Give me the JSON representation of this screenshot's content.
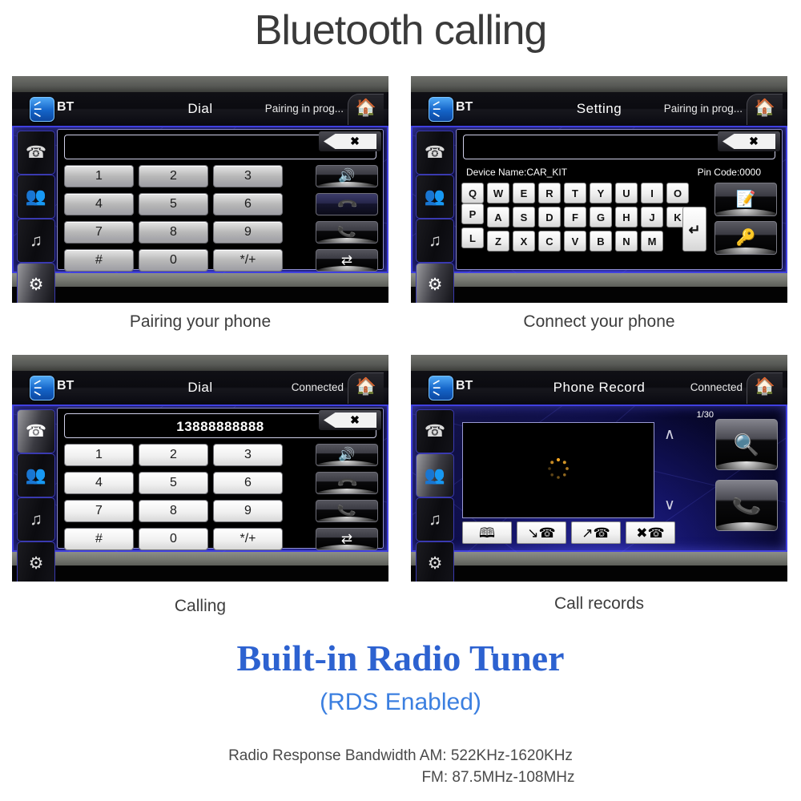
{
  "page": {
    "title": "Bluetooth calling",
    "radio_title": "Built-in Radio Tuner",
    "radio_subtitle": "(RDS Enabled)",
    "radio_spec_line1": "Radio Response Bandwidth AM: 522KHz-1620KHz",
    "radio_spec_line2": "FM: 87.5MHz-108MHz",
    "accent_blue": "#2d62d0",
    "accent_light_blue": "#3b7fe0",
    "screen_border_blue": "#4040e0"
  },
  "common": {
    "bt_badge_icon": "bluetooth-icon",
    "bt_label": "BT",
    "home_icon": "home-icon",
    "delete_icon": "backspace-delete-icon",
    "rail": [
      {
        "icon": "phone-icon",
        "name": "phone"
      },
      {
        "icon": "contacts-icon",
        "name": "contacts"
      },
      {
        "icon": "bt-music-icon",
        "name": "bt-music"
      },
      {
        "icon": "gear-icon",
        "name": "settings"
      }
    ],
    "keypad_keys": [
      "1",
      "2",
      "3",
      "4",
      "5",
      "6",
      "7",
      "8",
      "9",
      "#",
      "0",
      "*/+"
    ],
    "dial_actions": [
      {
        "icon": "speaker-transfer-icon",
        "name": "audio-transfer"
      },
      {
        "icon": "end-call-icon",
        "name": "end-call"
      },
      {
        "icon": "answer-call-icon",
        "name": "answer-call"
      },
      {
        "icon": "swap-icon",
        "name": "swap-audio"
      }
    ]
  },
  "panels": [
    {
      "id": "pairing",
      "title": "Dial",
      "status": "Pairing in prog...",
      "selected_rail": 3,
      "number_value": "",
      "caption": "Pairing your phone"
    },
    {
      "id": "setting",
      "title": "Setting",
      "status": "Pairing in prog...",
      "selected_rail": 3,
      "input_value": "",
      "device_name_label": "Device Name:CAR_KIT",
      "pin_code_label": "Pin Code:0000",
      "keyboard_row1": [
        "Q",
        "W",
        "E",
        "R",
        "T",
        "Y",
        "U",
        "I",
        "O",
        "P"
      ],
      "keyboard_row2": [
        "A",
        "S",
        "D",
        "F",
        "G",
        "H",
        "J",
        "K",
        "L"
      ],
      "keyboard_row3": [
        "Z",
        "X",
        "C",
        "V",
        "B",
        "N",
        "M"
      ],
      "enter_key": "enter-key",
      "side_buttons": [
        {
          "icon": "edit-name-icon",
          "name": "edit-device-name"
        },
        {
          "icon": "edit-pin-icon",
          "name": "edit-pin-code"
        }
      ],
      "caption": "Connect your phone"
    },
    {
      "id": "calling",
      "title": "Dial",
      "status": "Connected",
      "selected_rail": 0,
      "number_value": "13888888888",
      "caption": "Calling"
    },
    {
      "id": "records",
      "title": "Phone Record",
      "status": "Connected",
      "selected_rail": 1,
      "page_counter": "1/30",
      "scroll_up_icon": "chevron-up-icon",
      "scroll_down_icon": "chevron-down-icon",
      "loading_icon": "loading-spinner-icon",
      "record_buttons": [
        {
          "icon": "phonebook-icon",
          "name": "phonebook"
        },
        {
          "icon": "received-calls-icon",
          "name": "received-calls"
        },
        {
          "icon": "dialed-calls-icon",
          "name": "dialed-calls"
        },
        {
          "icon": "missed-calls-icon",
          "name": "missed-calls"
        }
      ],
      "big_buttons": [
        {
          "icon": "search-icon",
          "name": "search"
        },
        {
          "icon": "answer-call-icon",
          "name": "call"
        }
      ],
      "caption": "Call records"
    }
  ]
}
